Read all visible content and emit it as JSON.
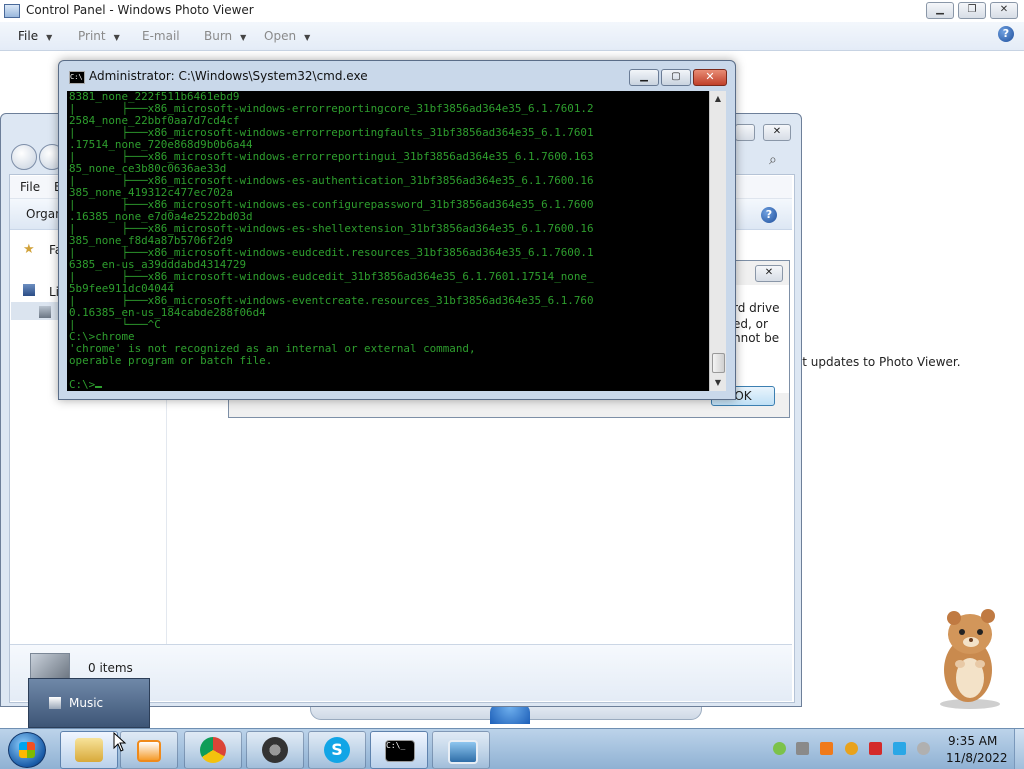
{
  "photo_viewer": {
    "title": "Control Panel - Windows Photo Viewer",
    "menu": {
      "file": "File",
      "print": "Print",
      "email": "E-mail",
      "burn": "Burn",
      "open": "Open"
    },
    "body_text": "st updates to Photo Viewer."
  },
  "explorer": {
    "menu_file": "File",
    "menu_e": "E",
    "organize": "Organ",
    "nav_favorites": "Fa",
    "nav_libraries": "Li",
    "items_count": "0 items",
    "tooltip_label": "Music"
  },
  "dialog": {
    "lines": [
      "rd drive",
      "ed, or",
      "nnot be"
    ],
    "ok": "OK"
  },
  "cmd": {
    "title": "Administrator: C:\\Windows\\System32\\cmd.exe",
    "icon_text": "C:\\",
    "lines": [
      "8381_none_222f511b6461ebd9",
      "|       ├───x86_microsoft-windows-errorreportingcore_31bf3856ad364e35_6.1.7601.2",
      "2584_none_22bbf0aa7d7cd4cf",
      "|       ├───x86_microsoft-windows-errorreportingfaults_31bf3856ad364e35_6.1.7601",
      ".17514_none_720e868d9b0b6a44",
      "|       ├───x86_microsoft-windows-errorreportingui_31bf3856ad364e35_6.1.7600.163",
      "85_none_ce3b80c0636ae33d",
      "|       ├───x86_microsoft-windows-es-authentication_31bf3856ad364e35_6.1.7600.16",
      "385_none_419312c477ec702a",
      "|       ├───x86_microsoft-windows-es-configurepassword_31bf3856ad364e35_6.1.7600",
      ".16385_none_e7d0a4e2522bd03d",
      "|       ├───x86_microsoft-windows-es-shellextension_31bf3856ad364e35_6.1.7600.16",
      "385_none_f8d4a87b5706f2d9",
      "|       ├───x86_microsoft-windows-eudcedit.resources_31bf3856ad364e35_6.1.7600.1",
      "6385_en-us_a39dddabd4314729",
      "|       ├───x86_microsoft-windows-eudcedit_31bf3856ad364e35_6.1.7601.17514_none_",
      "5b9fee911dc04044",
      "|       ├───x86_microsoft-windows-eventcreate.resources_31bf3856ad364e35_6.1.760",
      "0.16385_en-us_184cabde288f06d4",
      "|       └───^C",
      "C:\\>chrome",
      "'chrome' is not recognized as an internal or external command,",
      "operable program or batch file.",
      "",
      "C:\\>"
    ]
  },
  "taskbar": {
    "clock_time": "9:35 AM",
    "clock_date": "11/8/2022",
    "skype_glyph": "S",
    "cmd_glyph": "C:\\_"
  },
  "colors": {
    "console_text": "#2e9e2e",
    "console_bg": "#000000",
    "taskbar": "#9fbddc"
  }
}
